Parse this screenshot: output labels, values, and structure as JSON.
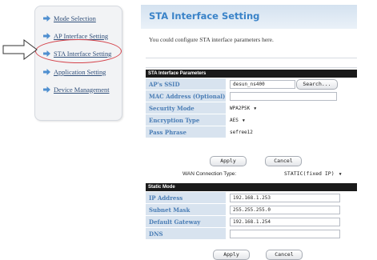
{
  "nav": {
    "items": [
      {
        "label": "Mode Selection",
        "active": false
      },
      {
        "label": "AP Interface Setting",
        "active": false
      },
      {
        "label": "STA Interface Setting",
        "active": true
      },
      {
        "label": "Application Setting",
        "active": false
      },
      {
        "label": "Device Management",
        "active": false
      }
    ]
  },
  "colors": {
    "highlight": "#d5434b",
    "accent": "#3a83c8",
    "key_cell": "#d8e3ef"
  },
  "page": {
    "title": "STA Interface Setting",
    "description": "You could configure STA interface parameters here."
  },
  "sta": {
    "header": "STA Interface Parameters",
    "ssid_label": "AP's SSID",
    "ssid_value": "desun_ns400",
    "search_label": "Search...",
    "mac_label": "MAC Address (Optional)",
    "mac_value": "",
    "security_label": "Security Mode",
    "security_value": "WPA2PSK",
    "encryption_label": "Encryption Type",
    "encryption_value": "AES",
    "pass_label": "Pass Phrase",
    "pass_value": "sefree12"
  },
  "buttons": {
    "apply": "Apply",
    "cancel": "Cancel"
  },
  "wan": {
    "label": "WAN Connection Type:",
    "value": "STATIC(fixed IP)"
  },
  "static": {
    "header": "Static Mode",
    "ip_label": "IP Address",
    "ip_value": "192.168.1.253",
    "mask_label": "Subnet Mask",
    "mask_value": "255.255.255.0",
    "gateway_label": "Default Gateway",
    "gateway_value": "192.168.1.254",
    "dns_label": "DNS",
    "dns_value": ""
  }
}
